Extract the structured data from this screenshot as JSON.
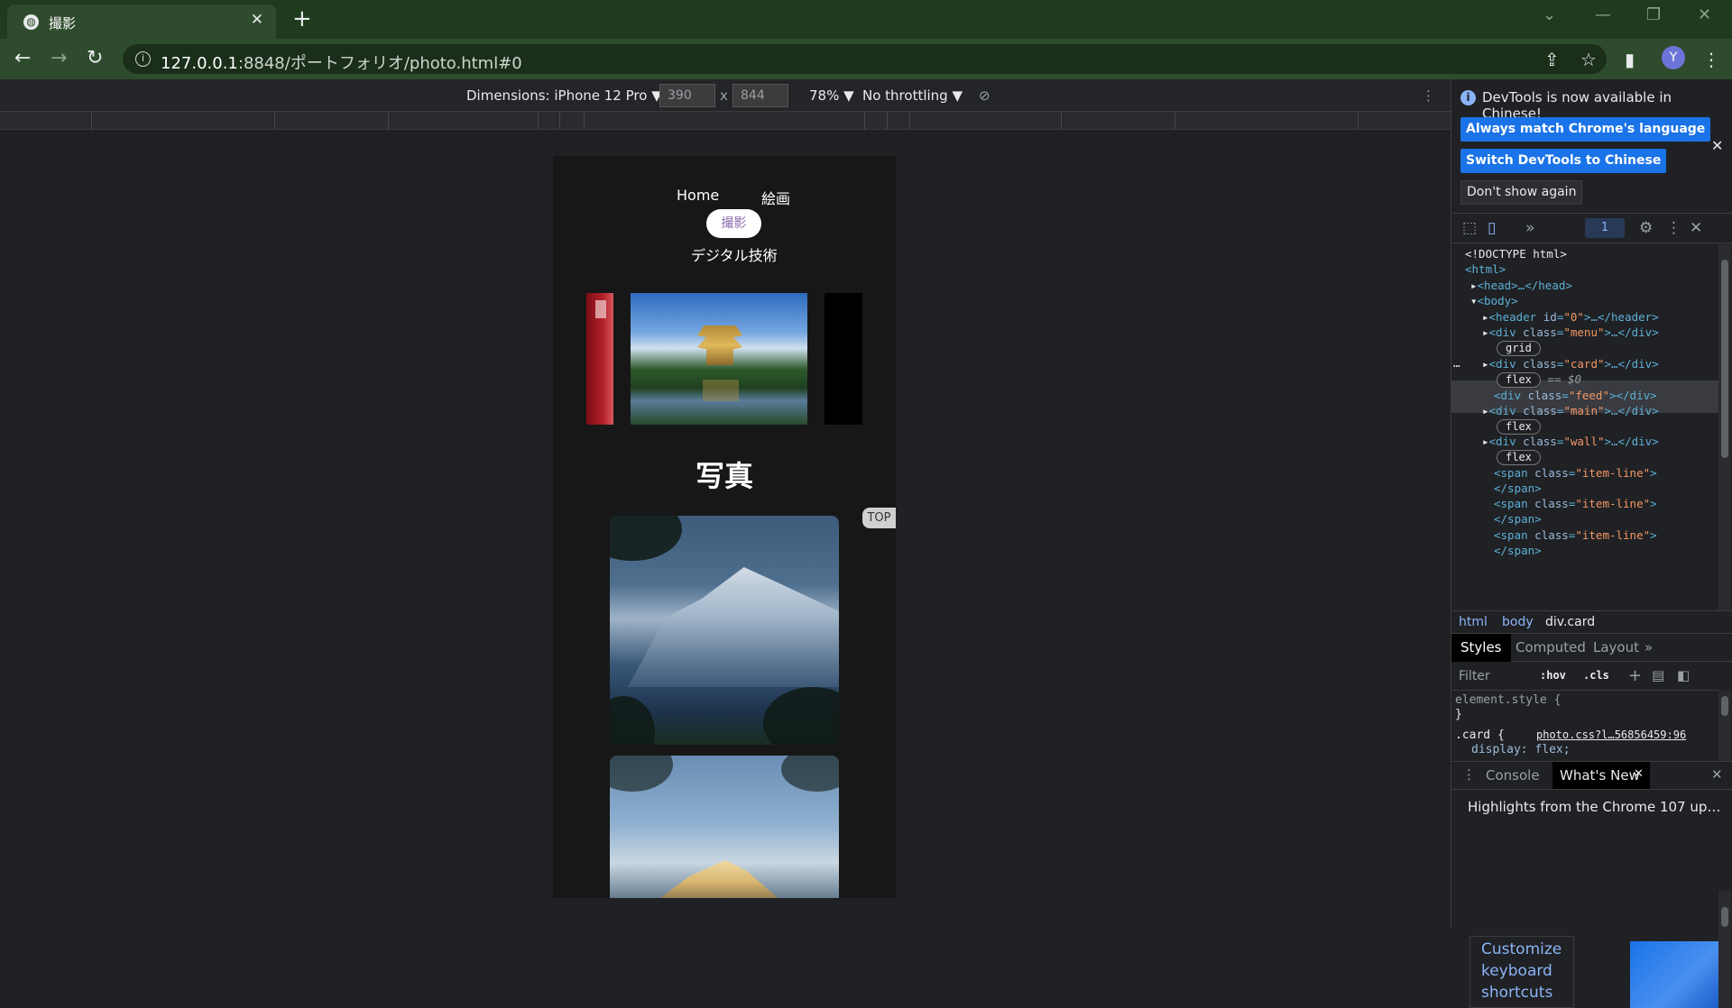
{
  "browser": {
    "tab_title": "撮影",
    "url_host": "127.0.0.1",
    "url_rest": ":8848/ポートフォリオ/photo.html#0",
    "avatar_letter": "Y"
  },
  "device_toolbar": {
    "dimensions_label": "Dimensions: iPhone 12 Pro ▼",
    "width": "390",
    "height": "844",
    "times": "x",
    "zoom": "78% ▼",
    "throttling": "No throttling ▼"
  },
  "page": {
    "nav": {
      "home": "Home",
      "kaiga": "絵画",
      "satsuei": "撮影",
      "digital": "デジタル技術"
    },
    "title": "写真",
    "top_button": "TOP"
  },
  "devtools": {
    "banner": {
      "message": "DevTools is now available in Chinese!",
      "btn_match": "Always match Chrome's language",
      "btn_switch": "Switch DevTools to Chinese",
      "btn_dont": "Don't show again"
    },
    "issues_count": "1",
    "dom": {
      "doctype": "<!DOCTYPE html>",
      "html_open": "<html>",
      "head": "<head>…</head>",
      "body_open": "<body>",
      "header_tag": "<header",
      "header_attr": "id",
      "header_val": "\"0\"",
      "header_close": ">…</header>",
      "menu_tag": "<div",
      "menu_attr": "class",
      "menu_val": "\"menu\"",
      "menu_close": ">…</div>",
      "grid_pill": "grid",
      "card_val": "\"card\"",
      "flex_pill": "flex",
      "dollar": "== $0",
      "feed_val": "\"feed\"",
      "feed_close": "></div>",
      "main_val": "\"main\"",
      "wall_val": "\"wall\"",
      "span_tag": "<span",
      "item_line_val": "\"item-line\"",
      "span_gt": ">",
      "span_close": "</span>",
      "dots": "…",
      "eq": "="
    },
    "breadcrumbs": [
      "html",
      "body",
      "div.card"
    ],
    "style_tabs": [
      "Styles",
      "Computed",
      "Layout"
    ],
    "filter_placeholder": "Filter",
    "hov": ":hov",
    "cls": ".cls",
    "styles": {
      "element_style": "element.style {",
      "close_brace": "}",
      "card_selector": ".card {",
      "card_source": "photo.css?l…56856459:96",
      "display_decl": "display: flex;"
    },
    "drawer_tabs": [
      "Console",
      "What's New"
    ],
    "whatsnew_headline": "Highlights from the Chrome 107 up…",
    "card_link_lines": [
      "Customize",
      "keyboard",
      "shortcuts"
    ]
  }
}
